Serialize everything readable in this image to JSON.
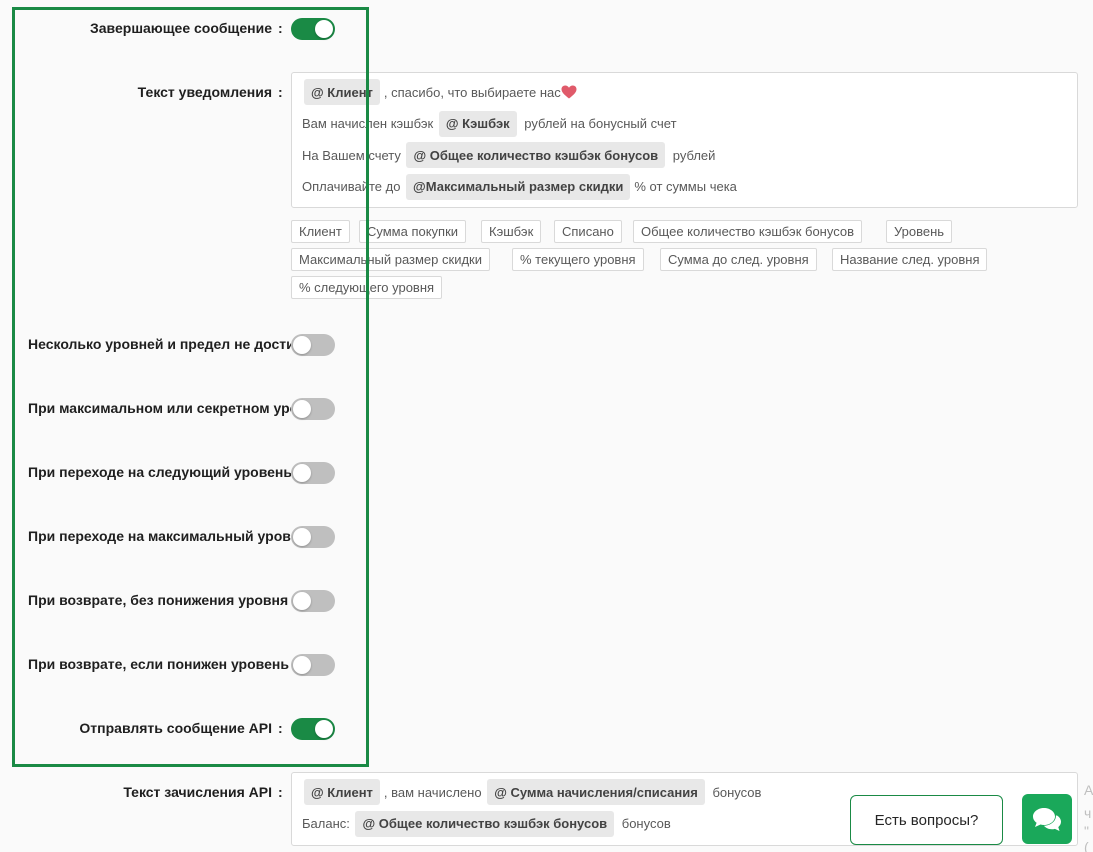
{
  "settings": {
    "final_message": {
      "label": "Завершающее сообщение",
      "on": true
    },
    "notification_text_label": "Текст уведомления",
    "notification_lines": [
      {
        "parts": [
          {
            "chip": "@ Клиент"
          },
          {
            "text": ", спасибо, что выбираете нас"
          },
          {
            "icon": "heart"
          }
        ]
      },
      {
        "parts": [
          {
            "text": "Вам начислен кэшбэк "
          },
          {
            "chip": "@ Кэшбэк"
          },
          {
            "text": " рублей на бонусный счет"
          }
        ]
      },
      {
        "parts": [
          {
            "text": "На Вашем счету "
          },
          {
            "chip": "@ Общее количество кэшбэк бонусов"
          },
          {
            "text": " рублей"
          }
        ]
      },
      {
        "parts": [
          {
            "text": "Оплачивайте до "
          },
          {
            "chip": "@Максимальный размер скидки"
          },
          {
            "text": "% от суммы чека"
          }
        ]
      }
    ],
    "tags": [
      "Клиент",
      "Сумма покупки",
      "Кэшбэк",
      "Списано",
      "Общее количество кэшбэк бонусов",
      "Уровень",
      "Максимальный размер скидки",
      "% текущего уровня",
      "Сумма до след. уровня",
      "Название след. уровня",
      "% следующего уровня"
    ],
    "toggles": [
      {
        "label": "Несколько уровней и предел не достигнут",
        "on": false
      },
      {
        "label": "При максимальном или секретном уровне",
        "on": false
      },
      {
        "label": "При переходе на следующий уровень",
        "on": false
      },
      {
        "label": "При переходе на максимальный уровень",
        "on": false
      },
      {
        "label": "При возврате, без понижения уровня",
        "on": false
      },
      {
        "label": "При возврате, если понижен уровень",
        "on": false
      }
    ],
    "send_api": {
      "label": "Отправлять сообщение API",
      "on": true
    },
    "api_text_label": "Текст зачисления API",
    "api_lines": [
      {
        "parts": [
          {
            "chip": "@ Клиент"
          },
          {
            "text": ", вам начислено "
          },
          {
            "chip": "@ Сумма начисления/списания"
          },
          {
            "text": " бонусов"
          }
        ]
      },
      {
        "parts": [
          {
            "text": "Баланс: "
          },
          {
            "chip": "@ Общее количество кэшбэк бонусов"
          },
          {
            "text": " бонусов"
          }
        ]
      }
    ],
    "colon": ":"
  },
  "help": {
    "label": "Есть вопросы?"
  },
  "edge": [
    "А",
    "ч",
    "\"("
  ],
  "colors": {
    "accent": "#1a8a45",
    "chat": "#1aa85a",
    "heart": "#e05a6a"
  }
}
